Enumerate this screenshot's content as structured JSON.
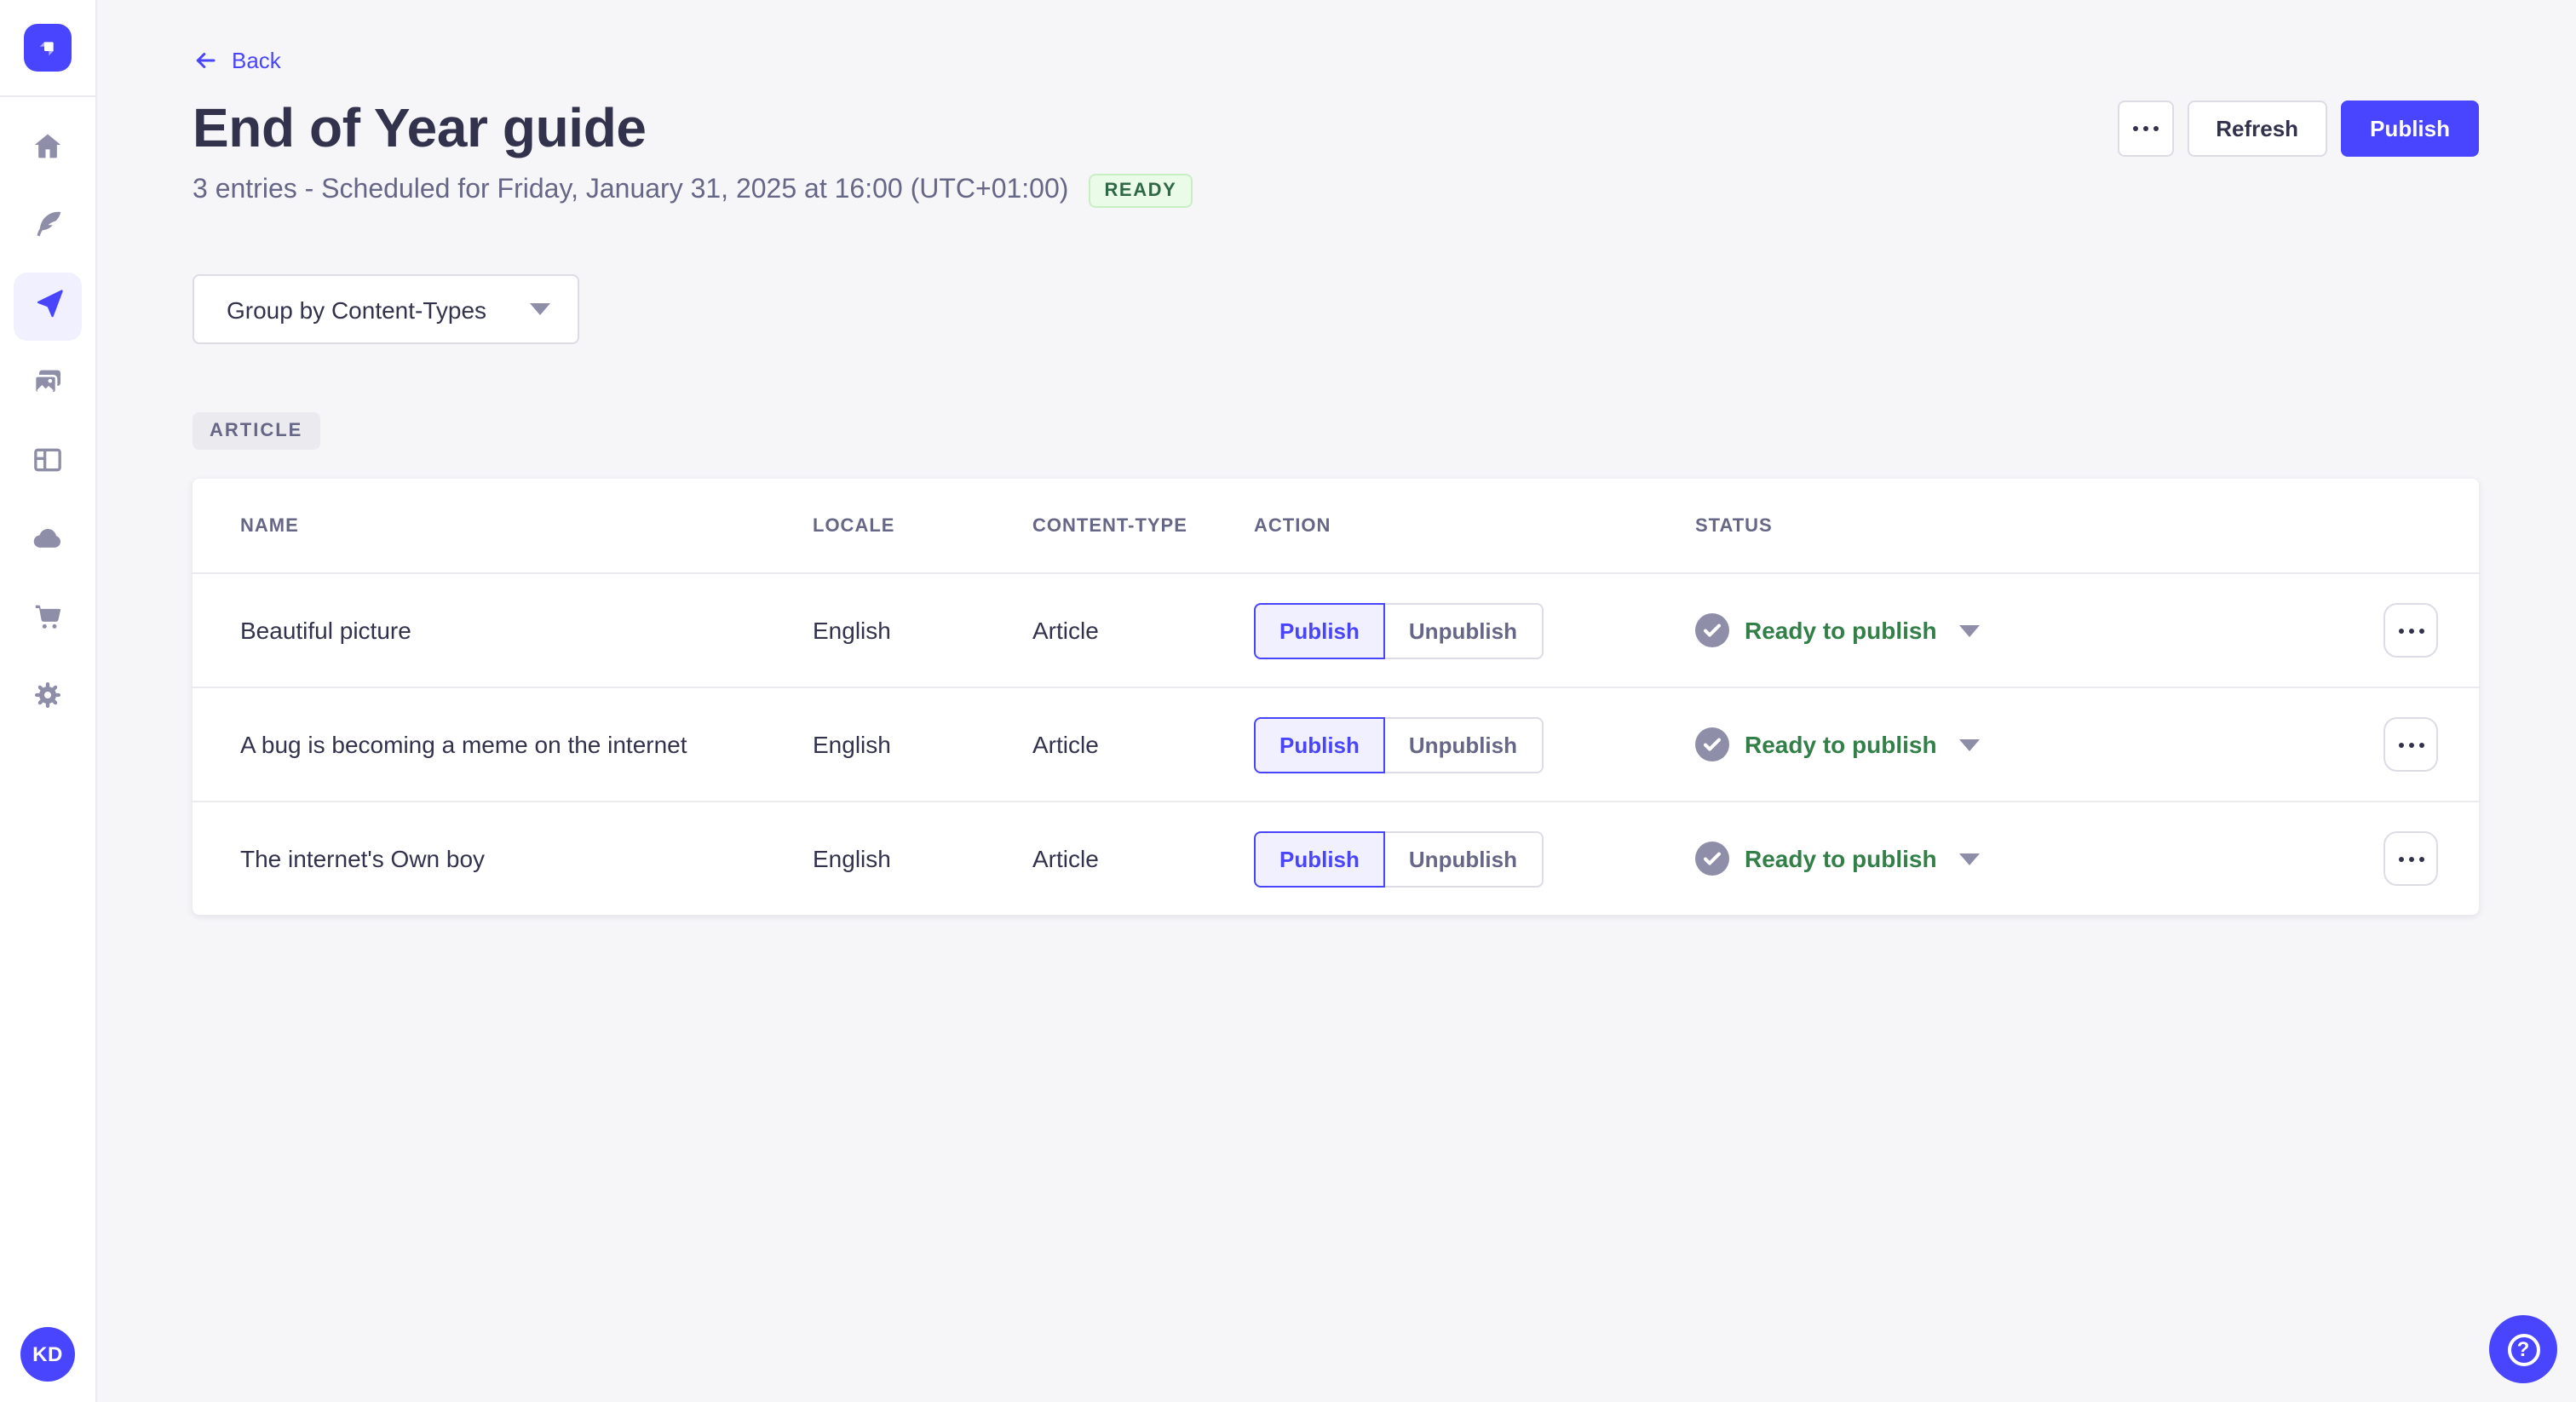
{
  "sidebar": {
    "nav": [
      {
        "id": "home",
        "icon": "home-icon",
        "active": false
      },
      {
        "id": "content-manager",
        "icon": "feather-icon",
        "active": false
      },
      {
        "id": "releases",
        "icon": "paper-plane-icon",
        "active": true
      },
      {
        "id": "media-library",
        "icon": "images-icon",
        "active": false
      },
      {
        "id": "content-type-builder",
        "icon": "layout-icon",
        "active": false
      },
      {
        "id": "cloud",
        "icon": "cloud-icon",
        "active": false
      },
      {
        "id": "marketplace",
        "icon": "cart-icon",
        "active": false
      },
      {
        "id": "settings",
        "icon": "gear-icon",
        "active": false
      }
    ],
    "avatar_initials": "KD"
  },
  "header": {
    "back_label": "Back",
    "title": "End of Year guide",
    "subtitle": "3 entries - Scheduled for Friday, January 31, 2025 at 16:00 (UTC+01:00)",
    "release_status_badge": "READY",
    "refresh_label": "Refresh",
    "publish_label": "Publish"
  },
  "toolbar": {
    "group_by_value": "Group by Content-Types"
  },
  "group": {
    "badge": "ARTICLE"
  },
  "table": {
    "headers": [
      "NAME",
      "LOCALE",
      "CONTENT-TYPE",
      "ACTION",
      "STATUS"
    ],
    "rows": [
      {
        "name": "Beautiful picture",
        "locale": "English",
        "content_type": "Article",
        "publish_label": "Publish",
        "unpublish_label": "Unpublish",
        "status": "Ready to publish"
      },
      {
        "name": "A bug is becoming a meme on the internet",
        "locale": "English",
        "content_type": "Article",
        "publish_label": "Publish",
        "unpublish_label": "Unpublish",
        "status": "Ready to publish"
      },
      {
        "name": "The internet's Own boy",
        "locale": "English",
        "content_type": "Article",
        "publish_label": "Publish",
        "unpublish_label": "Unpublish",
        "status": "Ready to publish"
      }
    ]
  },
  "colors": {
    "accent": "#4945ff",
    "accent_light": "#f0f0ff",
    "success_text": "#328048",
    "ready_badge_bg": "#eafbe7",
    "ready_badge_border": "#c6f0c2",
    "ready_badge_text": "#2f6846",
    "neutral_icon": "#8e8ea9",
    "text_dark": "#32324d",
    "text_muted": "#666687",
    "page_bg": "#f6f6f9"
  }
}
